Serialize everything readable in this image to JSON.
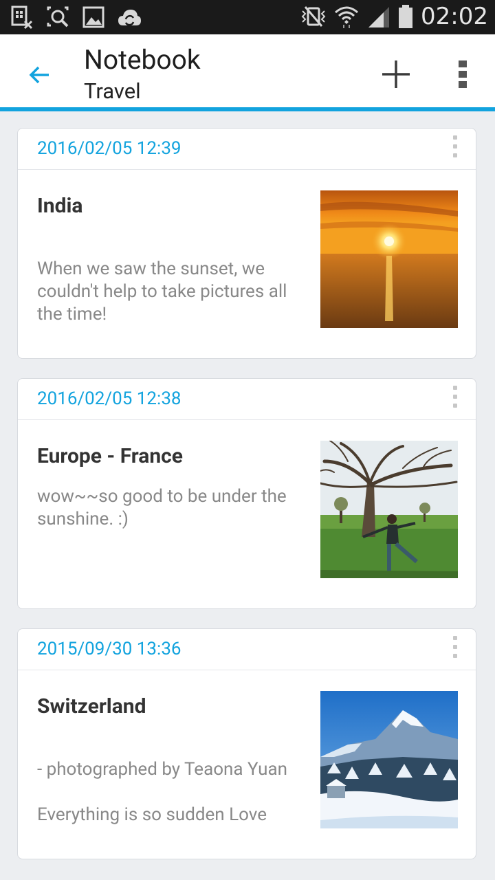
{
  "status_bar": {
    "time": "02:02",
    "left_icons": [
      "storage-icon",
      "screenshot-search-icon",
      "image-icon",
      "cloud-sync-icon"
    ],
    "right_icons": [
      "vibrate-icon",
      "wifi-icon",
      "signal-icon",
      "battery-icon"
    ]
  },
  "app_bar": {
    "title": "Notebook",
    "subtitle": "Travel",
    "back_icon": "arrow-back-icon",
    "add_icon": "plus-icon",
    "menu_icon": "overflow-menu-icon",
    "accent_color": "#12a3de"
  },
  "notes": [
    {
      "date": "2016/02/05 12:39",
      "title": "India",
      "body": "When we saw the sunset, we couldn't help to take pictures all the time!",
      "image": "sunset-over-sea"
    },
    {
      "date": "2016/02/05 12:38",
      "title": "Europe - France",
      "body": "wow~~so good to be under the sunshine. :)",
      "image": "woman-under-tree"
    },
    {
      "date": "2015/09/30 13:36",
      "title": "Switzerland",
      "body": "- photographed by Teaona Yuan\n\nEverything is so sudden Love",
      "image": "snowy-mountain"
    }
  ]
}
